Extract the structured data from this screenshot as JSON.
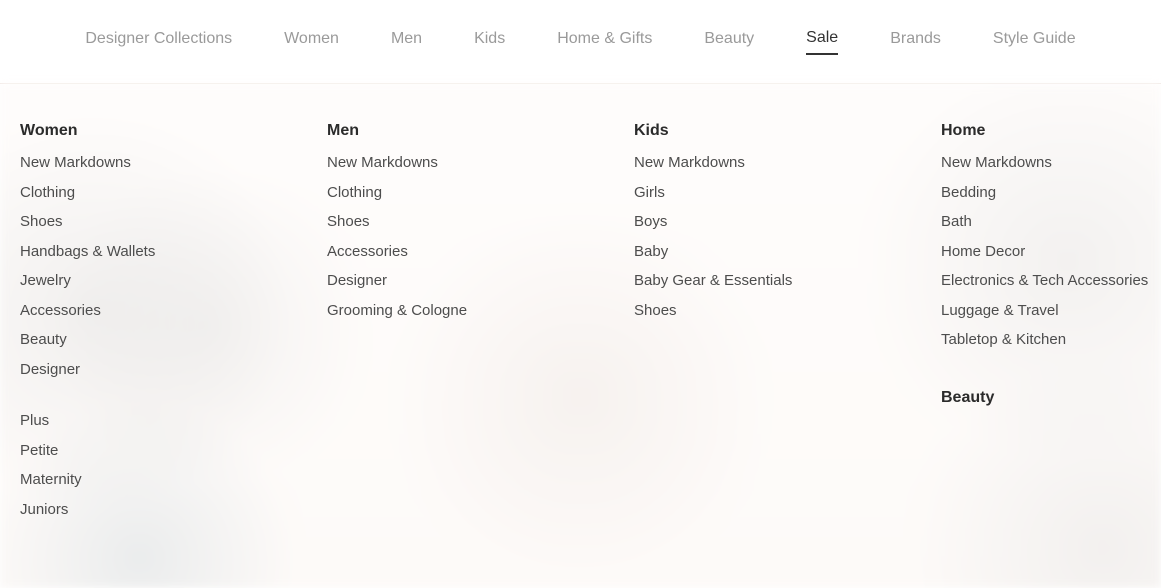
{
  "topnav": {
    "items": [
      {
        "label": "Designer Collections",
        "active": false
      },
      {
        "label": "Women",
        "active": false
      },
      {
        "label": "Men",
        "active": false
      },
      {
        "label": "Kids",
        "active": false
      },
      {
        "label": "Home & Gifts",
        "active": false
      },
      {
        "label": "Beauty",
        "active": false
      },
      {
        "label": "Sale",
        "active": true
      },
      {
        "label": "Brands",
        "active": false
      },
      {
        "label": "Style Guide",
        "active": false
      }
    ]
  },
  "dropdown": {
    "columns": [
      {
        "heading": "Women",
        "groups": [
          [
            "New Markdowns",
            "Clothing",
            "Shoes",
            "Handbags & Wallets",
            "Jewelry",
            "Accessories",
            "Beauty",
            "Designer"
          ],
          [
            "Plus",
            "Petite",
            "Maternity",
            "Juniors"
          ]
        ]
      },
      {
        "heading": "Men",
        "groups": [
          [
            "New Markdowns",
            "Clothing",
            "Shoes",
            "Accessories",
            "Designer",
            "Grooming & Cologne"
          ]
        ]
      },
      {
        "heading": "Kids",
        "groups": [
          [
            "New Markdowns",
            "Girls",
            "Boys",
            "Baby",
            "Baby Gear & Essentials",
            "Shoes"
          ]
        ]
      },
      {
        "heading": "Home",
        "groups": [
          [
            "New Markdowns",
            "Bedding",
            "Bath",
            "Home Decor",
            "Electronics & Tech Accessories",
            "Luggage & Travel",
            "Tabletop & Kitchen"
          ]
        ],
        "extra_heading": "Beauty"
      }
    ]
  }
}
